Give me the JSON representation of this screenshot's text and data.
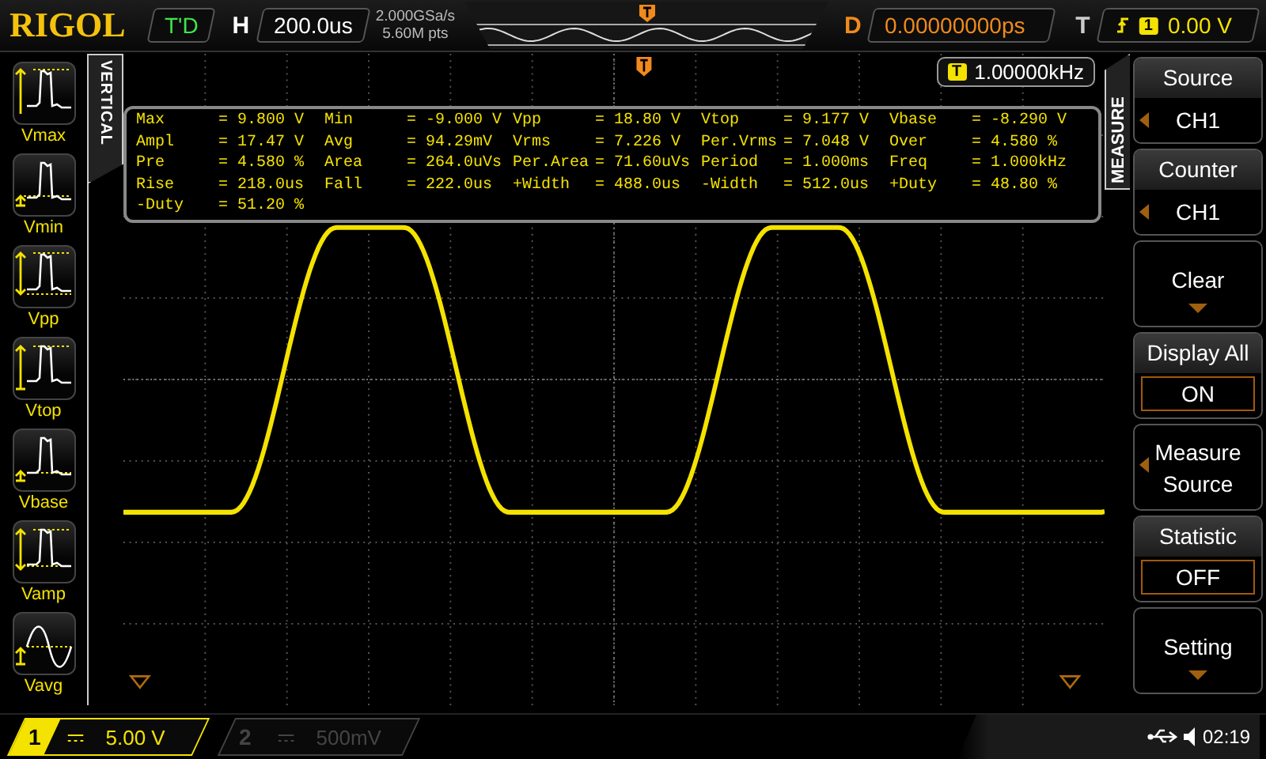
{
  "top_bar": {
    "logo": "RIGOL",
    "status": "T'D",
    "horizontal_label": "H",
    "timebase": "200.0us",
    "sample_rate": "2.000GSa/s",
    "memory_depth": "5.60M pts",
    "delay_label": "D",
    "delay": "0.00000000ps",
    "trigger_label": "T",
    "trigger_source": "1",
    "trigger_level": "0.00 V"
  },
  "left_panel": {
    "tab": "VERTICAL",
    "items": [
      {
        "kind": "max",
        "label": "Vmax"
      },
      {
        "kind": "min",
        "label": "Vmin"
      },
      {
        "kind": "pp",
        "label": "Vpp"
      },
      {
        "kind": "top",
        "label": "Vtop"
      },
      {
        "kind": "base",
        "label": "Vbase"
      },
      {
        "kind": "amp",
        "label": "Vamp"
      },
      {
        "kind": "avg",
        "label": "Vavg"
      }
    ]
  },
  "counter": {
    "source": "T",
    "value": "1.00000kHz"
  },
  "measurements": [
    {
      "name": "Max",
      "value": "= 9.800 V"
    },
    {
      "name": "Min",
      "value": "= -9.000 V"
    },
    {
      "name": "Vpp",
      "value": "= 18.80 V"
    },
    {
      "name": "Vtop",
      "value": "= 9.177 V"
    },
    {
      "name": "Vbase",
      "value": "= -8.290 V"
    },
    {
      "name": "Ampl",
      "value": "= 17.47 V"
    },
    {
      "name": "Avg",
      "value": "= 94.29mV"
    },
    {
      "name": "Vrms",
      "value": "= 7.226 V"
    },
    {
      "name": "Per.Vrms",
      "value": "= 7.048 V"
    },
    {
      "name": "Over",
      "value": "= 4.580 %"
    },
    {
      "name": "Pre",
      "value": "= 4.580 %"
    },
    {
      "name": "Area",
      "value": "= 264.0uVs"
    },
    {
      "name": "Per.Area",
      "value": "= 71.60uVs"
    },
    {
      "name": "Period",
      "value": "= 1.000ms"
    },
    {
      "name": "Freq",
      "value": "= 1.000kHz"
    },
    {
      "name": "Rise",
      "value": "= 218.0us"
    },
    {
      "name": "Fall",
      "value": "= 222.0us"
    },
    {
      "name": "+Width",
      "value": "= 488.0us"
    },
    {
      "name": "-Width",
      "value": "= 512.0us"
    },
    {
      "name": "+Duty",
      "value": "= 48.80 %"
    },
    {
      "name": "-Duty",
      "value": "= 51.20 %"
    }
  ],
  "menu": {
    "tab": "MEASURE",
    "items": [
      {
        "kind": "select",
        "title": "Source",
        "value": "CH1"
      },
      {
        "kind": "select",
        "title": "Counter",
        "value": "CH1"
      },
      {
        "kind": "submenu",
        "title": "Clear"
      },
      {
        "kind": "toggle",
        "title": "Display All",
        "value": "ON"
      },
      {
        "kind": "cycle",
        "title": "Measure",
        "value": "Source"
      },
      {
        "kind": "toggle",
        "title": "Statistic",
        "value": "OFF"
      },
      {
        "kind": "submenu",
        "title": "Setting"
      }
    ]
  },
  "channels": [
    {
      "number": "1",
      "scale": "5.00 V",
      "on": true
    },
    {
      "number": "2",
      "scale": "500mV",
      "on": false
    }
  ],
  "clock": "02:19"
}
